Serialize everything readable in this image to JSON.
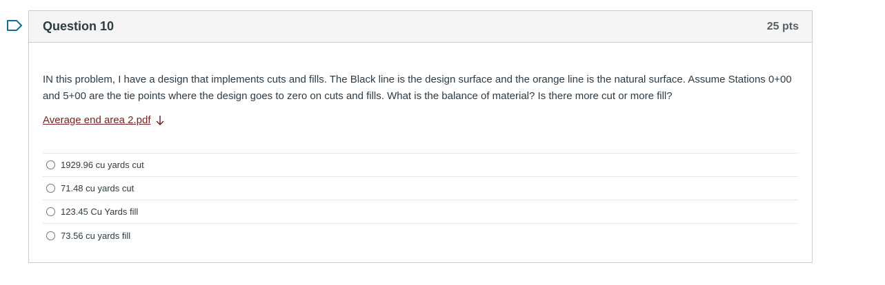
{
  "question": {
    "title": "Question 10",
    "points": "25 pts",
    "text": "IN this problem, I have a design that implements cuts and fills.  The Black line is the design surface and the orange line is the natural surface.  Assume Stations 0+00 and 5+00 are the tie points where the design goes to zero on cuts and fills.  What is the balance of material? Is there more cut or more fill?",
    "attachment_label": "Average end area 2.pdf",
    "answers": [
      {
        "label": "1929.96 cu yards cut"
      },
      {
        "label": "71.48 cu yards cut"
      },
      {
        "label": "123.45 Cu Yards fill"
      },
      {
        "label": "73.56 cu yards fill"
      }
    ]
  },
  "icons": {
    "flag": "flag-icon",
    "download": "download-arrow-icon",
    "radio": "radio-unselected-icon"
  },
  "colors": {
    "link": "#7b1f1f",
    "flag": "#0770a3",
    "border": "#c7cdd1",
    "header_bg": "#f5f5f5"
  }
}
